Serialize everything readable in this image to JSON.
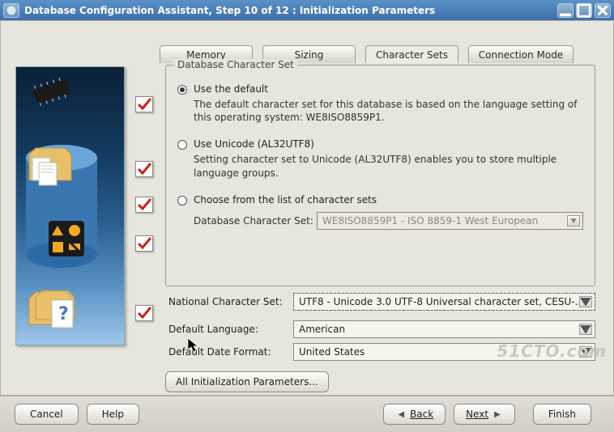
{
  "window": {
    "title": "Database Configuration Assistant, Step 10 of 12 : Initialization Parameters"
  },
  "tabs": {
    "memory": "Memory",
    "sizing": "Sizing",
    "charsets": "Character Sets",
    "connmode": "Connection Mode"
  },
  "fieldset": {
    "legend": "Database Character Set",
    "opt_default": {
      "label": "Use the default",
      "desc": "The default character set for this database is based on the language setting of this operating system: WE8ISO8859P1."
    },
    "opt_unicode": {
      "label": "Use Unicode (AL32UTF8)",
      "desc": "Setting character set to Unicode (AL32UTF8) enables you to store multiple language groups."
    },
    "opt_list": {
      "label": "Choose from the list of character sets",
      "row_label": "Database Character Set:",
      "combo_value": "WE8ISO8859P1 - ISO 8859-1 West European"
    }
  },
  "below": {
    "national_label": "National Character Set:",
    "national_value": "UTF8 - Unicode 3.0 UTF-8 Universal character set, CESU-...",
    "lang_label": "Default Language:",
    "lang_value": "American",
    "date_label": "Default Date Format:",
    "date_value": "United States"
  },
  "buttons": {
    "all_params": "All Initialization Parameters...",
    "cancel": "Cancel",
    "help": "Help",
    "back": "Back",
    "next": "Next",
    "finish": "Finish"
  },
  "watermark": "51CTO.com"
}
